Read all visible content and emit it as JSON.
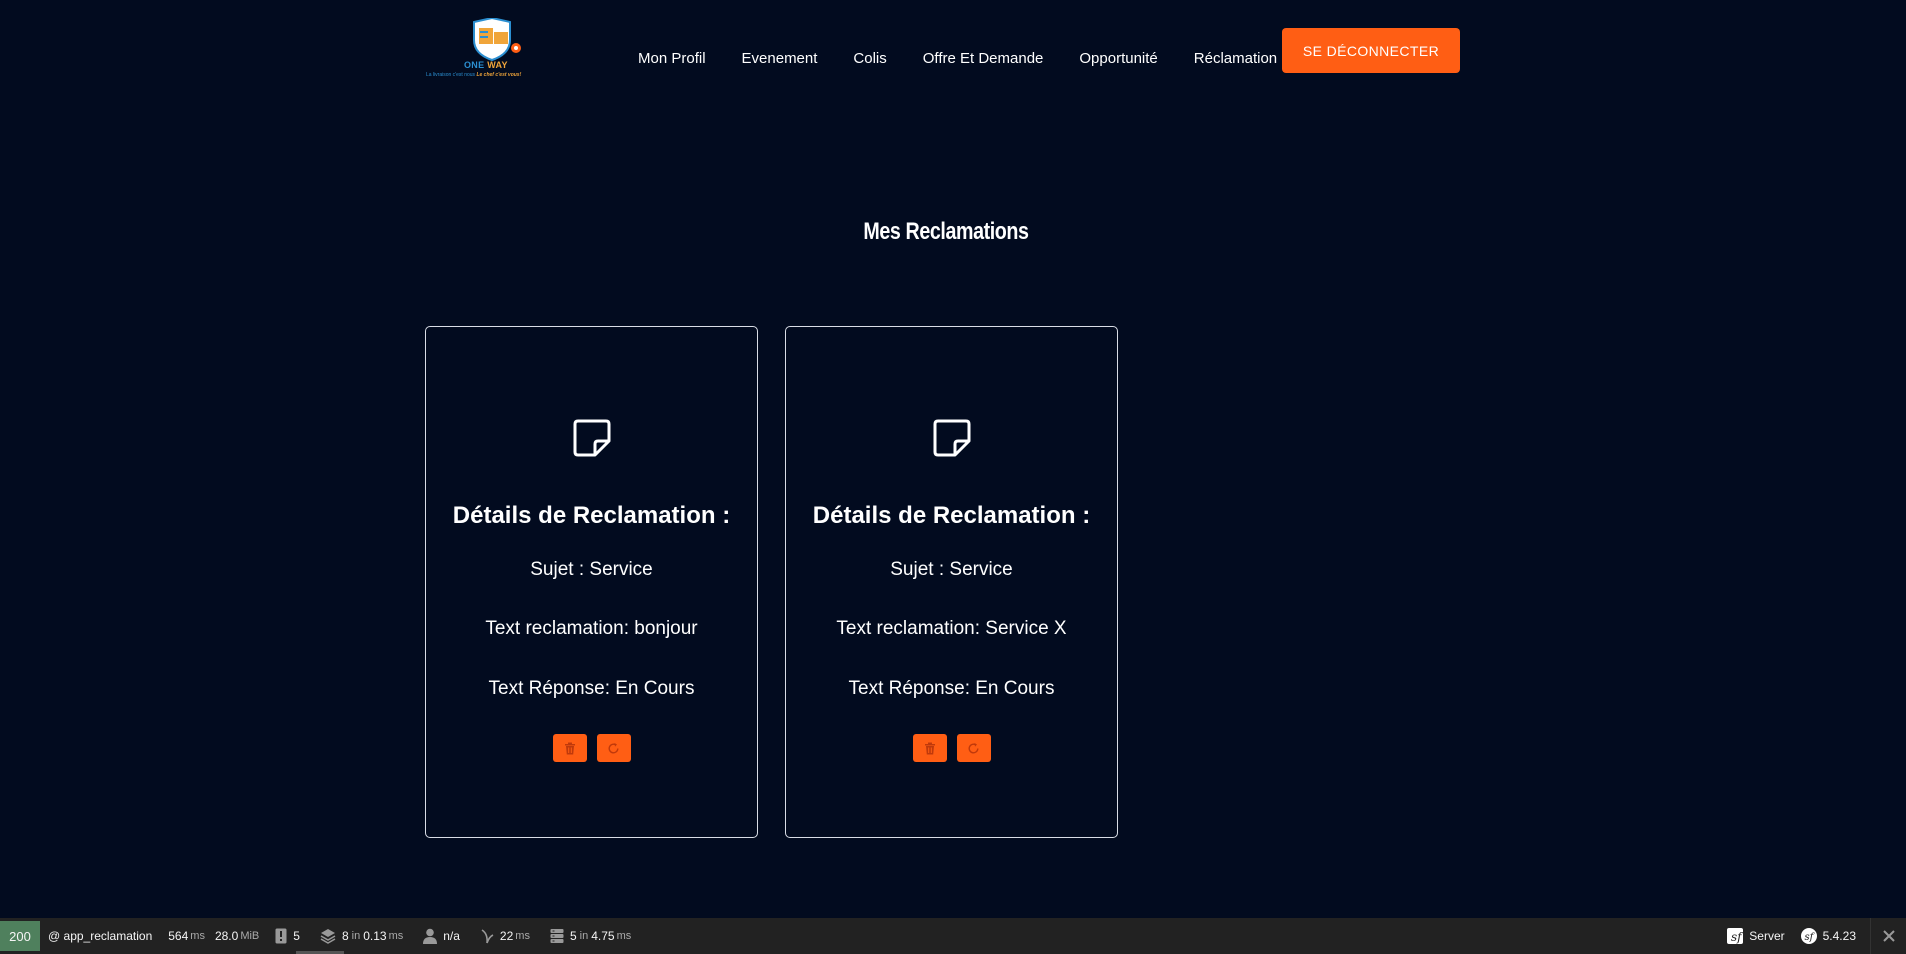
{
  "header": {
    "logo": {
      "brand_one": "ONE",
      "brand_way": "WAY",
      "tagline_a": "La livraison c'est nous",
      "tagline_b": "Le chef c'est vous!"
    },
    "nav": [
      {
        "label": "Mon Profil"
      },
      {
        "label": "Evenement"
      },
      {
        "label": "Colis"
      },
      {
        "label": "Offre Et Demande"
      },
      {
        "label": "Opportunité"
      },
      {
        "label": "Réclamation"
      }
    ],
    "logout_label": "SE DÉCONNECTER"
  },
  "main": {
    "title": "Mes Reclamations",
    "cards": [
      {
        "title": "Détails de Reclamation :",
        "sujet": "Sujet : Service",
        "text": "Text reclamation: bonjour",
        "reponse": "Text Réponse: En Cours"
      },
      {
        "title": "Détails de Reclamation :",
        "sujet": "Sujet : Service",
        "text": "Text reclamation: Service X",
        "reponse": "Text Réponse: En Cours"
      }
    ]
  },
  "toolbar": {
    "status": "200",
    "route": "@ app_reclamation",
    "time_value": "564",
    "time_unit": "ms",
    "memory_value": "28.0",
    "memory_unit": "MiB",
    "logs_count": "5",
    "twig_value": "8",
    "twig_in": "in",
    "twig_time": "0.13",
    "twig_unit": "ms",
    "user": "n/a",
    "events_value": "22",
    "events_unit": "ms",
    "db_value": "5",
    "db_in": "in",
    "db_time": "4.75",
    "db_unit": "ms",
    "server_label": "Server",
    "version": "5.4.23"
  },
  "colors": {
    "background": "#020b1f",
    "accent": "#ff5e14",
    "status_ok": "#4f805d"
  },
  "icons": {
    "card_icon": "sticky-note-icon",
    "delete_icon": "trash-icon",
    "update_icon": "refresh-icon"
  }
}
